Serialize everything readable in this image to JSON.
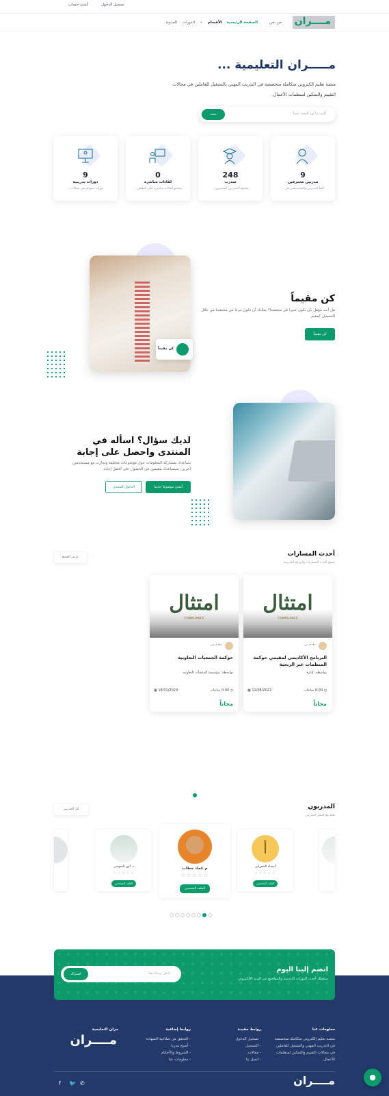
{
  "topbar": {
    "login": "تسجيل الدخول",
    "signup": "أنشئ حساب"
  },
  "brand": {
    "logo_text": "مــــران"
  },
  "nav": {
    "items": [
      {
        "label": "من نحن"
      },
      {
        "label": "الصفحة الرئيسية"
      },
      {
        "label": "الأقسام"
      },
      {
        "label": "الدورات"
      },
      {
        "label": "المدونة"
      }
    ]
  },
  "hero": {
    "title": "مـــــران التعليمية ...",
    "desc": "منصة تعليم إلكتروني متكاملة متخصصة في التدريب المهني بالتشغيل للعاملين في مجالات التقييم والتمكين لمنظمات الأعمال.",
    "search_placeholder": "أكتب ما تود البحث عنه!",
    "search_button": "بحث"
  },
  "stats": [
    {
      "num": "9",
      "label": "مدربين محترفين",
      "sub": "أكفأ المدربين والمتخصصين في..."
    },
    {
      "num": "248",
      "label": "متدرب",
      "sub": "مجتمع المتدربين المتميزين..."
    },
    {
      "num": "0",
      "label": "لقاءات مباشرة",
      "sub": "مجتمع لقاءات مباشرة على الملتقى..."
    },
    {
      "num": "9",
      "label": "دورات تدريبية",
      "sub": "دورات متنوعة في مجالات..."
    }
  ],
  "assessor": {
    "title": "كن مقيماً",
    "desc": "هل أنت مؤهل بأن تكون خبيرا في مجتمعنا؟ يمكنك أن تكون جزءا من مجتمعنا من خلال التسجيل كمقيم.",
    "button": "كن مقيماً",
    "badge": "كن مقيماً"
  },
  "forum": {
    "title": "لديك سؤال؟ اسأله في المنتدى واحصل على إجابة",
    "desc": "نساعدك بمشاركة المعلومات حول موضوعات مختلفة وتجارب مع مستخدمين آخرين، سيساعدك مقيمين في الحصول على أفضل إجابة.",
    "primary_button": "أنشئ موضوعا جديدا",
    "secondary_button": "الدخول للمنتدى"
  },
  "courses": {
    "title": "أحدث المسارات",
    "subtitle": "تصفح أحدث المسارات والبرامج التدريبية",
    "view_all": "عرض الجميع",
    "items": [
      {
        "brand": "امتثال",
        "brand_sub": "COMPLIANCE",
        "author": "مقدم من",
        "title": "البرنامج الأكاديمي لمقيمي حوكمة المنظمات غير الربحية",
        "by": "بواسطة: إدارة",
        "duration": "0:00 ساعات",
        "date": "11/08/2022",
        "price": "مجاناً"
      },
      {
        "brand": "امتثال",
        "brand_sub": "COMPLIANCE",
        "author": "مقدم من",
        "title": "حوكمة الجمعيات التعاونية",
        "by": "بواسطة: مؤسسة المنشآت التعاونية",
        "duration": "0:00 ساعات",
        "date": "18/01/2023",
        "price": "مجاناً"
      }
    ]
  },
  "trainers": {
    "title": "المدربون",
    "subtitle": "تعلم مع أفضل المدربين",
    "view_all": "كل المدربين",
    "items": [
      {
        "name": "...",
        "button": "الملف الشخصي"
      },
      {
        "name": "أسماء الشعراني",
        "button": "الملف الشخصي"
      },
      {
        "name": "م.عماد خطاب",
        "button": "الملف الشخصي"
      },
      {
        "name": "د. أنور السهيمي",
        "button": "الملف الشخصي"
      },
      {
        "name": "...",
        "button": "الملف الشخصي"
      }
    ],
    "avatar_letter": "أ",
    "stars": "☆☆☆☆☆"
  },
  "newsletter": {
    "title": "انضم إلينا اليوم",
    "desc": "ستصلك أحدث الدورات التدريبية والمواضيع عبر البريد الإلكتروني",
    "placeholder": "ادخل بريدك هنا",
    "button": "اشتراك"
  },
  "footer": {
    "col1_title": "معلومات عنا",
    "col1_text": "منصة تعليم إلكتروني متكاملة متخصصة في التدريب المهني والتشغيل للعاملين في مجالات التقييم والتمكين لمنظمات الأعمال.",
    "col2_title": "روابط مفيدة",
    "col2_links": [
      "- تسجيل الدخول",
      "- التسجيل",
      "- مقالات",
      "- اتصل بنا"
    ],
    "col3_title": "روابط إضافية",
    "col3_links": [
      "- التحقق من صلاحية الشهادة",
      "- أصبح مدربا",
      "- الشروط والأحكام",
      "- معلومات عنا"
    ],
    "col4_title": "مران التعليمية"
  },
  "colors": {
    "primary": "#0d9b6c",
    "navy": "#1e3763",
    "footer": "#22396a"
  }
}
